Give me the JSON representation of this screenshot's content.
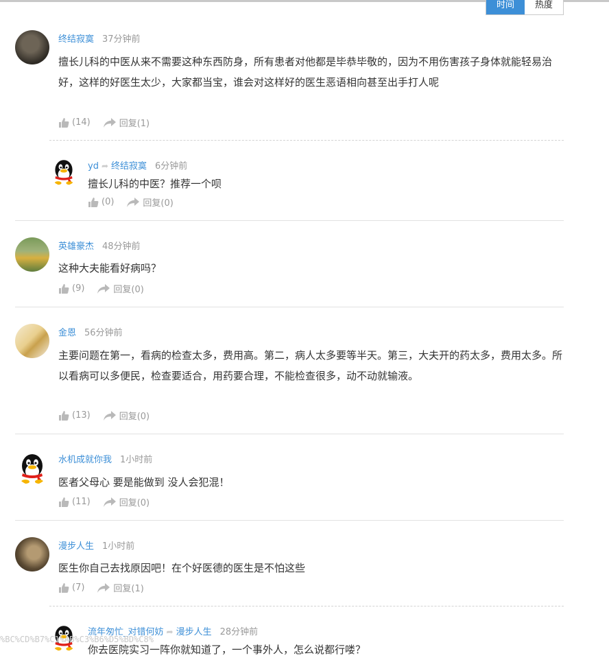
{
  "sort_tabs": [
    {
      "label": "时间"
    },
    {
      "label": "热度"
    }
  ],
  "comments": [
    {
      "user": "终结寂寞",
      "time": "37分钟前",
      "text": "擅长儿科的中医从来不需要这种东西防身，所有患者对他都是毕恭毕敬的，因为不用伤害孩子身体就能轻易治好，这样的好医生太少，大家都当宝，谁会对这样好的医生恶语相向甚至出手打人呢",
      "likes": "(14)",
      "reply_label": "回复(1)"
    },
    {
      "user": "英雄豪杰",
      "time": "48分钟前",
      "text": "这种大夫能看好病吗？",
      "likes": "(9)",
      "reply_label": "回复(0)"
    },
    {
      "user": "金恩",
      "time": "56分钟前",
      "text": "主要问题在第一，看病的检查太多，费用高。第二，病人太多要等半天。第三，大夫开的药太多，费用太多。所以看病可以多便民，检查要适合，用药要合理，不能检查很多，动不动就输液。",
      "likes": "(13)",
      "reply_label": "回复(0)"
    },
    {
      "user": "水机成就你我",
      "time": "1小时前",
      "text": "医者父母心 要是能做到 没人会犯混！",
      "likes": "(11)",
      "reply_label": "回复(0)"
    },
    {
      "user": "漫步人生",
      "time": "1小时前",
      "text": "医生你自己去找原因吧！在个好医德的医生是不怕这些",
      "likes": "(7)",
      "reply_label": "回复(1)"
    }
  ],
  "replies": [
    {
      "user": "yd",
      "to": "终结寂寞",
      "time": "6分钟前",
      "text": "擅长儿科的中医？推荐一个呗",
      "likes": "(0)",
      "reply_label": "回复(0)"
    },
    {
      "user": "流年匆忙_对错何妨",
      "to": "漫步人生",
      "time": "28分钟前",
      "text": "你去医院实习一阵你就知道了，一个事外人，怎么说都行喽？",
      "likes": "",
      "reply_label": ""
    }
  ],
  "status_url": "%BC%CD%B7%C1%AB%C3%B6%D5%BD%C8%"
}
